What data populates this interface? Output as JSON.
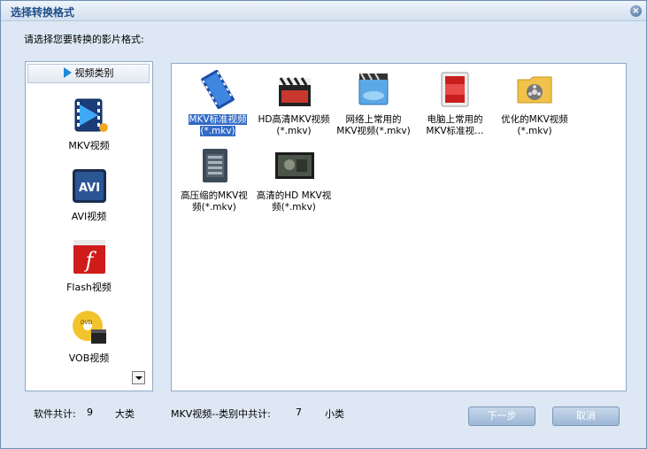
{
  "window": {
    "title": "选择转换格式",
    "prompt": "请选择您要转换的影片格式:"
  },
  "sidebar": {
    "header": "视频类别",
    "items": [
      {
        "label": "MKV视频",
        "icon": "mkv-film-icon"
      },
      {
        "label": "AVI视频",
        "icon": "avi-icon"
      },
      {
        "label": "Flash视频",
        "icon": "flash-icon"
      },
      {
        "label": "VOB视频",
        "icon": "dvd-disc-icon"
      }
    ]
  },
  "formats": [
    {
      "line1": "MKV标准视频",
      "line2": "(*.mkv)",
      "icon": "film-reel-icon",
      "selected": true
    },
    {
      "line1": "HD高清MKV视频",
      "line2": "(*.mkv)",
      "icon": "clapperboard-icon"
    },
    {
      "line1": "网络上常用的",
      "line2": "MKV视频(*.mkv)",
      "icon": "web-video-icon"
    },
    {
      "line1": "电脑上常用的",
      "line2": "MKV标准视…",
      "icon": "pc-video-icon"
    },
    {
      "line1": "优化的MKV视频",
      "line2": "(*.mkv)",
      "icon": "folder-reel-icon"
    },
    {
      "line1": "高压缩的MKV视",
      "line2": "频(*.mkv)",
      "icon": "compressed-file-icon"
    },
    {
      "line1": "高清的HD MKV视",
      "line2": "频(*.mkv)",
      "icon": "hd-movie-icon"
    }
  ],
  "status": {
    "software_total_label": "软件共计:",
    "software_total": "9",
    "software_unit": "大类",
    "category_total_label": "MKV视频--类别中共计:",
    "category_total": "7",
    "category_unit": "小类"
  },
  "buttons": {
    "next": "下一步",
    "cancel": "取消"
  },
  "colors": {
    "selection": "#3169c6",
    "accent": "#1f4e86",
    "button": "#9db7d6"
  }
}
